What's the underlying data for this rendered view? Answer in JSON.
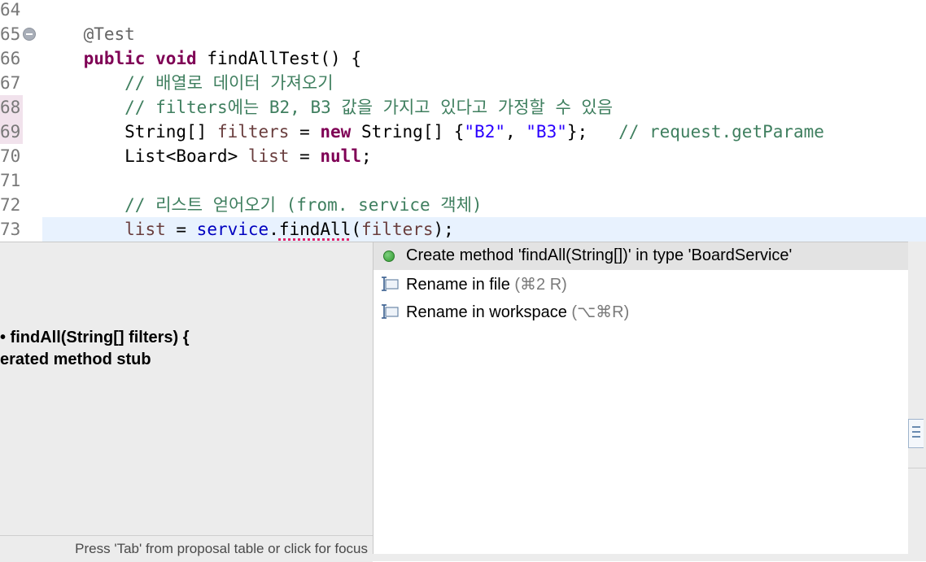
{
  "editor": {
    "lines": [
      {
        "num": "64",
        "tokens": []
      },
      {
        "num": "65",
        "tokens": [
          {
            "t": "    "
          },
          {
            "t": "@Test",
            "c": "ann"
          }
        ]
      },
      {
        "num": "66",
        "tokens": [
          {
            "t": "    "
          },
          {
            "t": "public",
            "c": "kw"
          },
          {
            "t": " "
          },
          {
            "t": "void",
            "c": "kw"
          },
          {
            "t": " findAllTest() {"
          }
        ]
      },
      {
        "num": "67",
        "tokens": [
          {
            "t": "        "
          },
          {
            "t": "// 배열로 데이터 가져오기",
            "c": "cm"
          }
        ]
      },
      {
        "num": "68",
        "tokens": [
          {
            "t": "        "
          },
          {
            "t": "// filters에는 B2, B3 값을 가지고 있다고 가정할 수 있음",
            "c": "cm"
          }
        ]
      },
      {
        "num": "69",
        "tokens": [
          {
            "t": "        String[] "
          },
          {
            "t": "filters",
            "c": "var"
          },
          {
            "t": " = "
          },
          {
            "t": "new",
            "c": "kw"
          },
          {
            "t": " String[] {"
          },
          {
            "t": "\"B2\"",
            "c": "str"
          },
          {
            "t": ", "
          },
          {
            "t": "\"B3\"",
            "c": "str"
          },
          {
            "t": "};   "
          },
          {
            "t": "// request.getParame",
            "c": "cm"
          }
        ]
      },
      {
        "num": "70",
        "tokens": [
          {
            "t": "        List<Board> "
          },
          {
            "t": "list",
            "c": "var"
          },
          {
            "t": " = "
          },
          {
            "t": "null",
            "c": "kw"
          },
          {
            "t": ";"
          }
        ]
      },
      {
        "num": "71",
        "tokens": []
      },
      {
        "num": "72",
        "tokens": [
          {
            "t": "        "
          },
          {
            "t": "// 리스트 얻어오기 (from. service 객체)",
            "c": "cm"
          }
        ]
      },
      {
        "num": "73",
        "tokens": [
          {
            "t": "        "
          },
          {
            "t": "list",
            "c": "var"
          },
          {
            "t": " = "
          },
          {
            "t": "service",
            "c": "fld"
          },
          {
            "t": "."
          },
          {
            "t": "findAll",
            "c": "err"
          },
          {
            "t": "("
          },
          {
            "t": "filters",
            "c": "var"
          },
          {
            "t": ");"
          }
        ]
      }
    ]
  },
  "info_pane": {
    "line1": "• findAll(String[] filters) {",
    "line2": "erated method stub",
    "footer": "Press 'Tab' from proposal table or click for focus"
  },
  "proposals": [
    {
      "label": "Create method 'findAll(String[])' in type 'BoardService'",
      "shortcut": "",
      "icon": "green-dot-icon"
    },
    {
      "label": "Rename in file",
      "shortcut": " (⌘2 R)",
      "icon": "rename-icon"
    },
    {
      "label": "Rename in workspace",
      "shortcut": " (⌥⌘R)",
      "icon": "rename-icon"
    }
  ]
}
